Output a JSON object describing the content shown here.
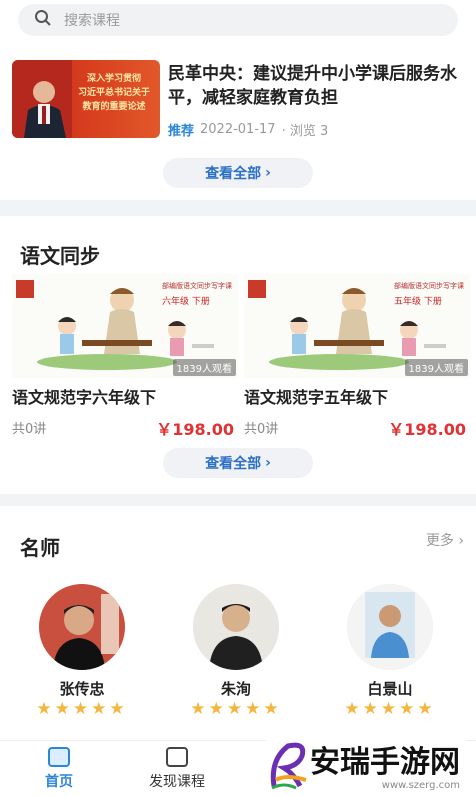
{
  "search": {
    "placeholder": "搜索课程"
  },
  "news": {
    "thumb_text": [
      "深入学习贯彻",
      "习近平总书记关于",
      "教育的重要论述"
    ],
    "title": "民革中央：建议提升中小学课后服务水平，减轻家庭教育负担",
    "tag": "推荐",
    "date": "2022-01-17",
    "views": "· 浏览 3"
  },
  "news_more": "查看全部",
  "chinese": {
    "title": "语文同步",
    "courses": [
      {
        "name": "语文规范字六年级下",
        "lessons": "共0讲",
        "price": "￥198.00",
        "badge": "1839人观看",
        "grade_label": "六年级 下册"
      },
      {
        "name": "语文规范字五年级下",
        "lessons": "共0讲",
        "price": "￥198.00",
        "badge": "1839人观看",
        "grade_label": "五年级 下册"
      }
    ],
    "more": "查看全部"
  },
  "teachers": {
    "title": "名师",
    "more": "更多",
    "list": [
      {
        "name": "张传忠",
        "rating": 5
      },
      {
        "name": "朱洵",
        "rating": 5
      },
      {
        "name": "白景山",
        "rating": 5
      }
    ]
  },
  "tabbar": {
    "home": "首页",
    "discover": "发现课程",
    "accent": "#2b86d9"
  },
  "watermark": {
    "text": "安瑞手游网",
    "url": "www.szerg.com"
  }
}
